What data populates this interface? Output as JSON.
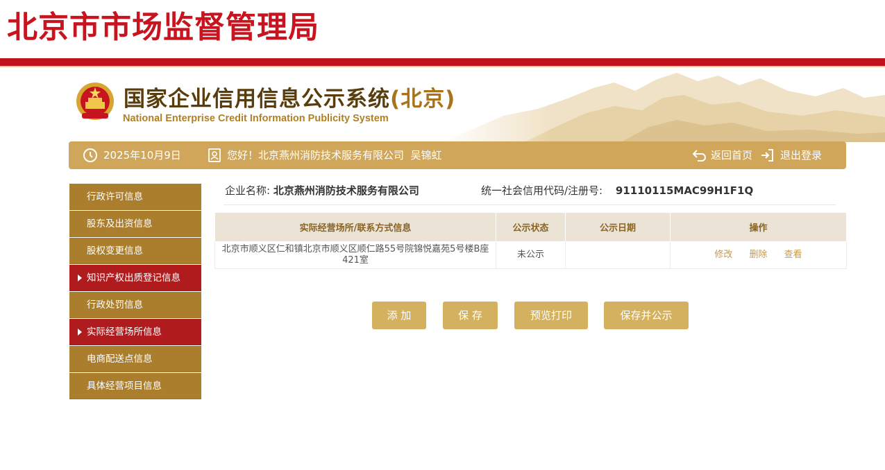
{
  "brand": {
    "title": "北京市市场监督管理局"
  },
  "system": {
    "title_cn": "国家企业信用信息公示系统",
    "title_region": "(北京)",
    "title_en": "National Enterprise Credit Information Publicity System"
  },
  "infobar": {
    "date": "2025年10月9日",
    "greeting": "您好！北京燕州消防技术服务有限公司  吴锦虹",
    "home_label": "返回首页",
    "logout_label": "退出登录"
  },
  "sidebar": {
    "items": [
      {
        "label": "行政许可信息",
        "active": false
      },
      {
        "label": "股东及出资信息",
        "active": false
      },
      {
        "label": "股权变更信息",
        "active": false
      },
      {
        "label": "知识产权出质登记信息",
        "active": true
      },
      {
        "label": "行政处罚信息",
        "active": false
      },
      {
        "label": "实际经营场所信息",
        "active": true
      },
      {
        "label": "电商配送点信息",
        "active": false
      },
      {
        "label": "具体经营项目信息",
        "active": false
      }
    ]
  },
  "company": {
    "name_label": "企业名称:",
    "name": "北京燕州消防技术服务有限公司",
    "code_label": "统一社会信用代码/注册号:",
    "code": "91110115MAC99H1F1Q"
  },
  "table": {
    "headers": [
      "实际经营场所/联系方式信息",
      "公示状态",
      "公示日期",
      "操作"
    ],
    "rows": [
      {
        "address": "北京市顺义区仁和镇北京市顺义区顺仁路55号院锦悦嘉苑5号楼B座421室",
        "status": "未公示",
        "date": "",
        "ops": {
          "edit": "修改",
          "delete": "删除",
          "view": "查看"
        }
      }
    ]
  },
  "buttons": {
    "add": "添 加",
    "save": "保 存",
    "preview": "预览打印",
    "save_publish": "保存并公示"
  },
  "colors": {
    "brand_red": "#c8141e",
    "gold_bar": "#d0a75a",
    "sidebar": "#ab7e2d",
    "sidebar_active": "#b01c1e",
    "button": "#d4b15f"
  }
}
